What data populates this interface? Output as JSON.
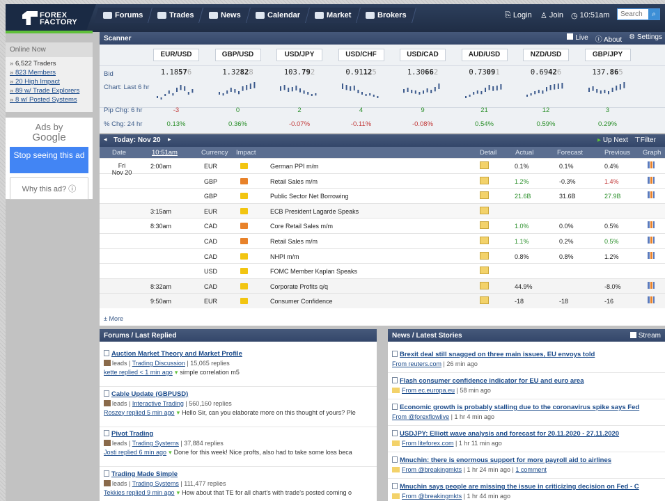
{
  "header": {
    "logo": "FOREX FACTORY",
    "nav": [
      "Forums",
      "Trades",
      "News",
      "Calendar",
      "Market",
      "Brokers"
    ],
    "login": "Login",
    "join": "Join",
    "time": "10:51am",
    "search_placeholder": "Search"
  },
  "sidebar": {
    "title": "Online Now",
    "items": [
      "6,522 Traders",
      "823 Members",
      "20 High Impact",
      "89 w/ Trade Explorers",
      "8 w/ Posted Systems"
    ]
  },
  "ads": {
    "by": "Ads by",
    "google": "Google",
    "stop": "Stop seeing this ad",
    "why": "Why this ad? ⓘ"
  },
  "scanner": {
    "title": "Scanner",
    "live": "Live",
    "about": "About",
    "settings": "Settings",
    "labels": {
      "bid": "Bid",
      "chart": "Chart: Last 6 hr",
      "pip": "Pip Chg: 6 hr",
      "pct": "% Chg: 24 hr"
    },
    "pairs": [
      {
        "name": "EUR/USD",
        "bid_a": "1.18",
        "bid_b": "57",
        "bid_c": "6",
        "pip": "-3",
        "pct": "0.13%",
        "pip_cls": "neg",
        "pct_cls": "pos"
      },
      {
        "name": "GBP/USD",
        "bid_a": "1.32",
        "bid_b": "82",
        "bid_c": "8",
        "pip": "0",
        "pct": "0.36%",
        "pip_cls": "pos",
        "pct_cls": "pos"
      },
      {
        "name": "USD/JPY",
        "bid_a": "103.",
        "bid_b": "79",
        "bid_c": "2",
        "pip": "2",
        "pct": "-0.07%",
        "pip_cls": "pos",
        "pct_cls": "neg"
      },
      {
        "name": "USD/CHF",
        "bid_a": "0.91",
        "bid_b": "12",
        "bid_c": "5",
        "pip": "4",
        "pct": "-0.11%",
        "pip_cls": "pos",
        "pct_cls": "neg"
      },
      {
        "name": "USD/CAD",
        "bid_a": "1.30",
        "bid_b": "66",
        "bid_c": "2",
        "pip": "9",
        "pct": "-0.08%",
        "pip_cls": "pos",
        "pct_cls": "neg"
      },
      {
        "name": "AUD/USD",
        "bid_a": "0.73",
        "bid_b": "09",
        "bid_c": "1",
        "pip": "21",
        "pct": "0.54%",
        "pip_cls": "pos",
        "pct_cls": "pos"
      },
      {
        "name": "NZD/USD",
        "bid_a": "0.69",
        "bid_b": "42",
        "bid_c": "6",
        "pip": "12",
        "pct": "0.59%",
        "pip_cls": "pos",
        "pct_cls": "pos"
      },
      {
        "name": "GBP/JPY",
        "bid_a": "137.",
        "bid_b": "86",
        "bid_c": "5",
        "pip": "3",
        "pct": "0.29%",
        "pip_cls": "pos",
        "pct_cls": "pos"
      }
    ]
  },
  "calendar": {
    "today": "Today: Nov 20",
    "up_next": "Up Next",
    "filter": "Filter",
    "cols": [
      "Date",
      "10:51am",
      "Currency",
      "Impact",
      "Detail",
      "Actual",
      "Forecast",
      "Previous",
      "Graph"
    ],
    "date_day": "Fri",
    "date": "Nov 20",
    "rows": [
      {
        "time": "2:00am",
        "cur": "EUR",
        "imp": "y",
        "event": "German PPI m/m",
        "actual": "0.1%",
        "a_cls": "",
        "forecast": "0.1%",
        "previous": "0.4%",
        "p_cls": ""
      },
      {
        "time": "",
        "cur": "GBP",
        "imp": "o",
        "event": "Retail Sales m/m",
        "actual": "1.2%",
        "a_cls": "pos",
        "forecast": "-0.3%",
        "previous": "1.4%",
        "p_cls": "neg"
      },
      {
        "time": "",
        "cur": "GBP",
        "imp": "y",
        "event": "Public Sector Net Borrowing",
        "actual": "21.6B",
        "a_cls": "pos",
        "forecast": "31.6B",
        "previous": "27.9B",
        "p_cls": "pos"
      },
      {
        "time": "3:15am",
        "cur": "EUR",
        "imp": "y",
        "event": "ECB President Lagarde Speaks",
        "actual": "",
        "a_cls": "",
        "forecast": "",
        "previous": "",
        "p_cls": ""
      },
      {
        "time": "8:30am",
        "cur": "CAD",
        "imp": "o",
        "event": "Core Retail Sales m/m",
        "actual": "1.0%",
        "a_cls": "pos",
        "forecast": "0.0%",
        "previous": "0.5%",
        "p_cls": ""
      },
      {
        "time": "",
        "cur": "CAD",
        "imp": "o",
        "event": "Retail Sales m/m",
        "actual": "1.1%",
        "a_cls": "pos",
        "forecast": "0.2%",
        "previous": "0.5%",
        "p_cls": "pos"
      },
      {
        "time": "",
        "cur": "CAD",
        "imp": "y",
        "event": "NHPI m/m",
        "actual": "0.8%",
        "a_cls": "",
        "forecast": "0.8%",
        "previous": "1.2%",
        "p_cls": ""
      },
      {
        "time": "",
        "cur": "USD",
        "imp": "y",
        "event": "FOMC Member Kaplan Speaks",
        "actual": "",
        "a_cls": "",
        "forecast": "",
        "previous": "",
        "p_cls": ""
      },
      {
        "time": "8:32am",
        "cur": "CAD",
        "imp": "y",
        "event": "Corporate Profits q/q",
        "actual": "44.9%",
        "a_cls": "",
        "forecast": "",
        "previous": "-8.0%",
        "p_cls": ""
      },
      {
        "time": "9:50am",
        "cur": "EUR",
        "imp": "y",
        "event": "Consumer Confidence",
        "actual": "-18",
        "a_cls": "",
        "forecast": "-18",
        "previous": "-16",
        "p_cls": ""
      }
    ],
    "more": "More"
  },
  "forums": {
    "title": "Forums / Last Replied",
    "items": [
      {
        "title": "Auction Market Theory and Market Profile",
        "leads": "leads",
        "cat": "Trading Discussion",
        "replies": "15,065 replies",
        "who": "kette replied < 1 min ago",
        "msg": "simple correlation m5"
      },
      {
        "title": "Cable Update (GBPUSD)",
        "leads": "leads",
        "cat": "Interactive Trading",
        "replies": "560,160 replies",
        "who": "Roszey replied 5 min ago",
        "msg": "Hello Sir, can you elaborate more on this thought of yours? Ple"
      },
      {
        "title": "Pivot Trading",
        "leads": "leads",
        "cat": "Trading Systems",
        "replies": "37,884 replies",
        "who": "Josti replied 6 min ago",
        "msg": "Done for this week! Nice profts, also had to take some loss beca"
      },
      {
        "title": "Trading Made Simple",
        "leads": "leads",
        "cat": "Trading Systems",
        "replies": "111,477 replies",
        "who": "Tekkies replied 9 min ago",
        "msg": "How about that TE for all chart's with trade's posted coming o"
      }
    ]
  },
  "news": {
    "title": "News / Latest Stories",
    "stream": "Stream",
    "items": [
      {
        "title": "Brexit deal still snagged on three main issues, EU envoys told",
        "src": "From reuters.com",
        "ago": "26 min ago",
        "extra": ""
      },
      {
        "title": "Flash consumer confidence indicator for EU and euro area",
        "src": "From ec.europa.eu",
        "ago": "58 min ago",
        "extra": ""
      },
      {
        "title": "Economic growth is probably stalling due to the coronavirus spike says Fed",
        "src": "From @forexflowlive",
        "ago": "1 hr 4 min ago",
        "extra": ""
      },
      {
        "title": "USDJPY: Elliott wave analysis and forecast for 20.11.2020 - 27.11.2020",
        "src": "From liteforex.com",
        "ago": "1 hr 11 min ago",
        "extra": ""
      },
      {
        "title": "Mnuchin: there is enormous support for more payroll aid to airlines",
        "src": "From @breakingmkts",
        "ago": "1 hr 24 min ago",
        "extra": "1 comment"
      },
      {
        "title": "Mnuchin says people are missing the issue in criticizing decision on Fed - C",
        "src": "From @breakingmkts",
        "ago": "1 hr 44 min ago",
        "extra": ""
      }
    ]
  }
}
